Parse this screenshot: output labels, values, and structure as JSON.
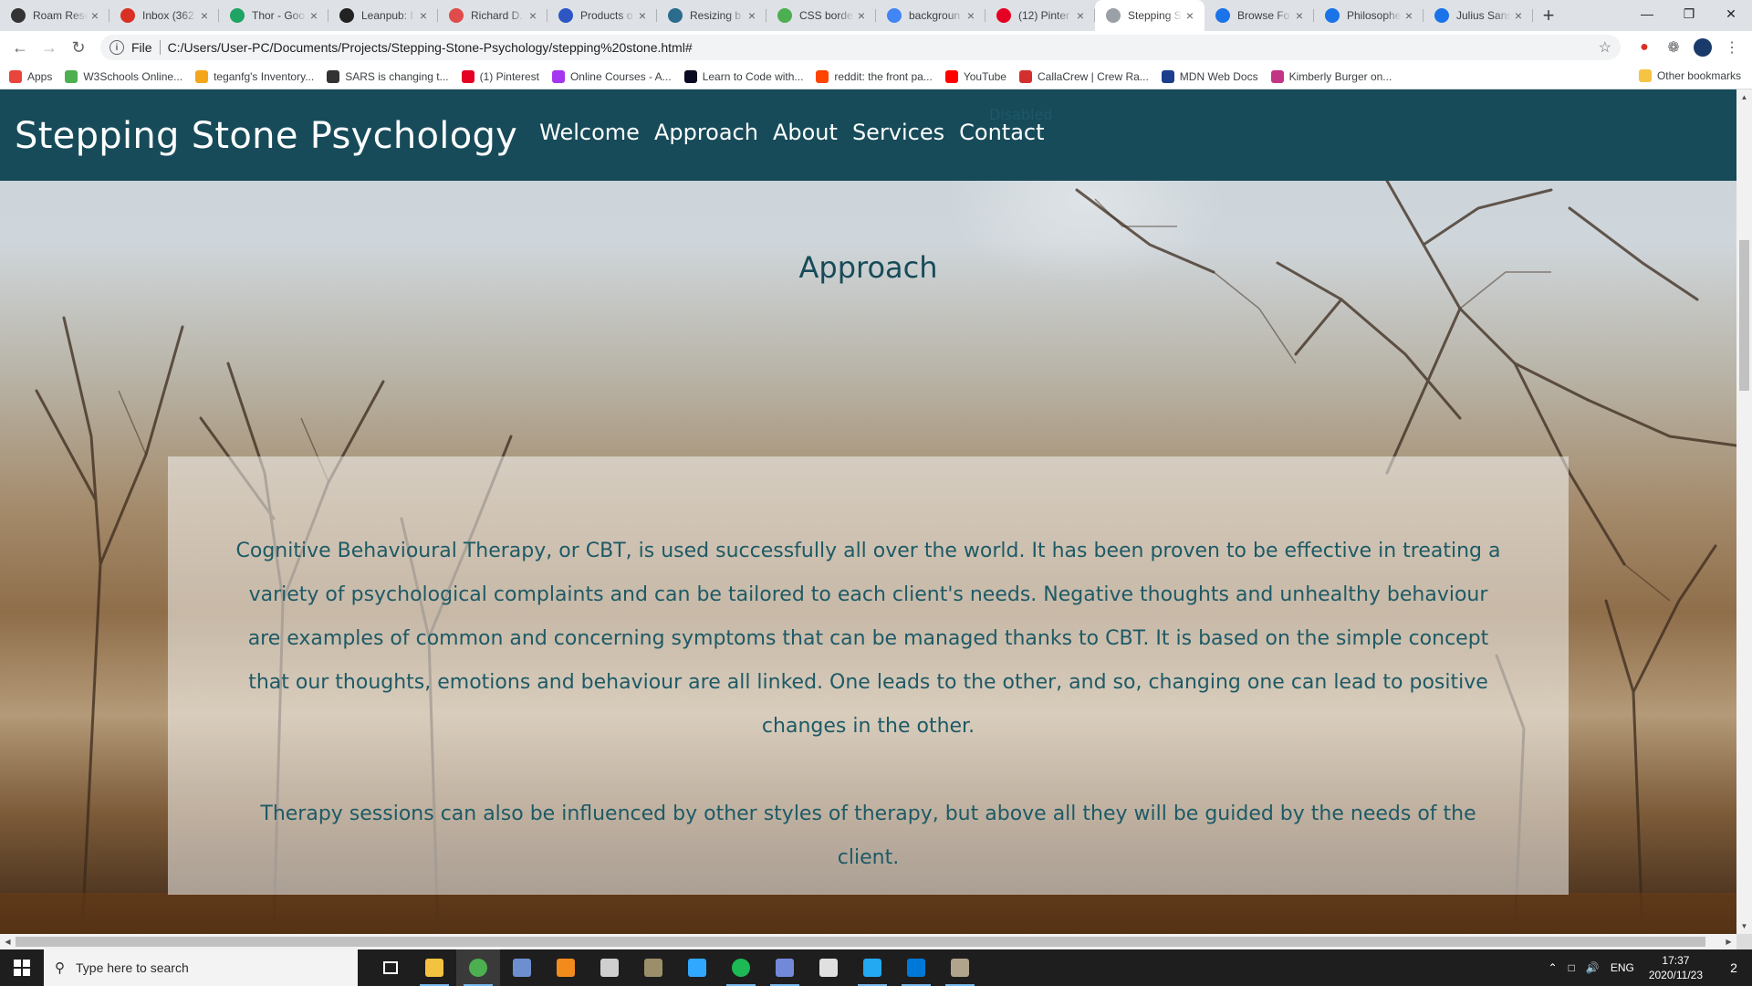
{
  "browser": {
    "tabs": [
      {
        "title": "Roam Rese",
        "icon": "roam-icon",
        "color": "#333333"
      },
      {
        "title": "Inbox (362",
        "icon": "gmail-icon",
        "color": "#d93025"
      },
      {
        "title": "Thor - Goo",
        "icon": "google-drive-icon",
        "color": "#1fa463"
      },
      {
        "title": "Leanpub: I",
        "icon": "leanpub-icon",
        "color": "#222222"
      },
      {
        "title": "Richard D.",
        "icon": "richard-icon",
        "color": "#e04b4b"
      },
      {
        "title": "Products o",
        "icon": "shield-icon",
        "color": "#2d56c4"
      },
      {
        "title": "Resizing b",
        "icon": "resizing-icon",
        "color": "#2a6c8c"
      },
      {
        "title": "CSS borde",
        "icon": "w3schools-icon",
        "color": "#4caf50"
      },
      {
        "title": "backgroun",
        "icon": "google-icon",
        "color": "#4285f4"
      },
      {
        "title": "(12) Pinter",
        "icon": "pinterest-icon",
        "color": "#e60023"
      },
      {
        "title": "Stepping S",
        "icon": "globe-icon",
        "color": "#9aa0a6",
        "active": true
      },
      {
        "title": "Browse Fo",
        "icon": "google-fonts-icon",
        "color": "#1a73e8"
      },
      {
        "title": "Philosophe",
        "icon": "google-fonts-icon",
        "color": "#1a73e8"
      },
      {
        "title": "Julius Sans",
        "icon": "google-fonts-icon",
        "color": "#1a73e8"
      }
    ],
    "omnibox": {
      "scheme_label": "File",
      "url": "C:/Users/User-PC/Documents/Projects/Stepping-Stone-Psychology/stepping%20stone.html#"
    },
    "bookmarks": [
      {
        "label": "Apps",
        "color": "#e8453c"
      },
      {
        "label": "W3Schools Online...",
        "color": "#4caf50"
      },
      {
        "label": "teganfg's Inventory...",
        "color": "#f4a61b"
      },
      {
        "label": "SARS is changing t...",
        "color": "#333333"
      },
      {
        "label": "(1) Pinterest",
        "color": "#e60023"
      },
      {
        "label": "Online Courses - A...",
        "color": "#a435f0"
      },
      {
        "label": "Learn to Code with...",
        "color": "#0a0a23"
      },
      {
        "label": "reddit: the front pa...",
        "color": "#ff4500"
      },
      {
        "label": "YouTube",
        "color": "#ff0000"
      },
      {
        "label": "CallaCrew | Crew Ra...",
        "color": "#d32f2f"
      },
      {
        "label": "MDN Web Docs",
        "color": "#1b3f8b"
      },
      {
        "label": "Kimberly Burger on...",
        "color": "#c13584"
      }
    ],
    "other_bookmarks": "Other bookmarks"
  },
  "site": {
    "brand": "Stepping Stone Psychology",
    "nav": [
      "Welcome",
      "Approach",
      "About",
      "Services",
      "Contact"
    ],
    "ghost_text": "Disabled",
    "section_title": "Approach",
    "paragraphs": [
      "Cognitive Behavioural Therapy, or CBT, is used successfully all over the world. It has been proven to be effective in treating a variety of psychological complaints and can be tailored to each client's needs. Negative thoughts and unhealthy behaviour are examples of common and concerning symptoms that can be managed thanks to CBT. It is based on the simple concept that our thoughts, emotions and behaviour are all linked. One leads to the other, and so, changing one can lead to positive changes in the other.",
      "Therapy sessions can also be influenced by other styles of therapy, but above all they will be guided by the needs of the client."
    ],
    "colors": {
      "nav_bg": "#174b59",
      "text": "#1d5a66"
    }
  },
  "taskbar": {
    "search_placeholder": "Type here to search",
    "apps": [
      "task-view-icon",
      "file-explorer-icon",
      "chrome-icon",
      "davinci-resolve-icon",
      "vlc-icon",
      "game-controller-icon",
      "tank-game-icon",
      "photoshop-icon",
      "spotify-icon",
      "discord-icon",
      "app-a-icon",
      "vscode-icon",
      "photos-icon",
      "gimp-icon"
    ],
    "language": "ENG",
    "time": "17:37",
    "date": "2020/11/23",
    "notification_count": "2"
  }
}
